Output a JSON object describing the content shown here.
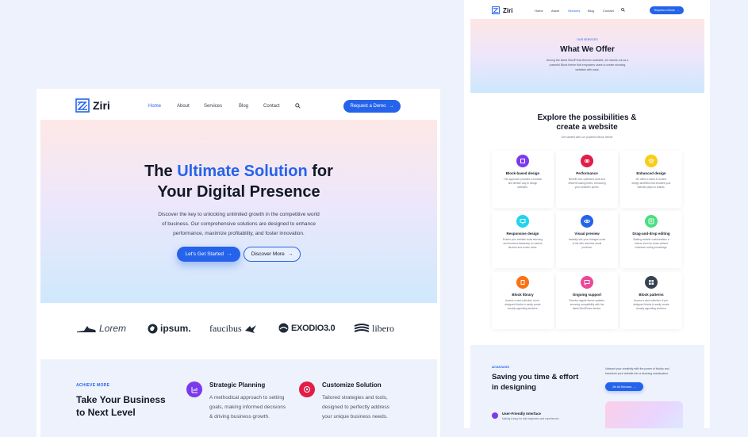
{
  "left": {
    "brand": "Ziri",
    "nav": [
      "Home",
      "About",
      "Services",
      "Blog",
      "Contact"
    ],
    "cta": "Request a Demo",
    "hero": {
      "title_pre": "The ",
      "title_accent": "Ultimate Solution",
      "title_post": " for",
      "title_line2": "Your Digital Presence",
      "desc": [
        "Discover the key to unlocking unlimited growth in the competitive world",
        "of business. Our comprehensive solutions are designed to enhance",
        "performance, maximize profitability, and foster innovation."
      ],
      "primary_button": "Let's Get Started",
      "secondary_button": "Discover More"
    },
    "logos": [
      "Lorem",
      "ipsum.",
      "faucibus",
      "EXODIO3.0",
      "libero"
    ],
    "features": {
      "kicker": "ACHIEVE MORE",
      "title_line1": "Take Your Business",
      "title_line2": "to Next Level",
      "items": [
        {
          "title": "Strategic Planning",
          "desc": [
            "A methodical approach to setting",
            "goals, making informed decisions",
            "& driving business growth."
          ],
          "color": "#7c3aed"
        },
        {
          "title": "Customize Solution",
          "desc": [
            "Tailored strategies and tools,",
            "designed to perfectly address",
            "your unique business needs."
          ],
          "color": "#e11d48"
        }
      ]
    }
  },
  "right": {
    "brand": "Ziri",
    "nav": [
      "Home",
      "Asset",
      "Services",
      "Blog",
      "Contact"
    ],
    "cta": "Request a Demo",
    "hero": {
      "kicker": "OUR SERVICES",
      "title": "What We Offer",
      "desc": [
        "Among the latest WordPress themes available, Ziri stands out as a",
        "powerful Block theme that empowers users to create stunning",
        "websites with ease."
      ]
    },
    "explore": {
      "title_line1": "Explore the possibilities &",
      "title_line2": "create a website",
      "sub": "Get started with our powerful Block theme"
    },
    "cards": [
      {
        "title": "Block-based design",
        "desc": [
          "This approach provides a modular",
          "and flexible way to design",
          "websites."
        ],
        "color": "#7c3aed",
        "icon": "cube-icon"
      },
      {
        "title": "Performance",
        "desc": [
          "Benefit from optimized code and",
          "efficient loading times, enhancing",
          "your website's speed."
        ],
        "color": "#e11d48",
        "icon": "link-icon"
      },
      {
        "title": "Enhanced design",
        "desc": [
          "Ziri offers a sleek & modern",
          "design aesthetic that elevates your",
          "website plays on brands."
        ],
        "color": "#facc15",
        "icon": "stack-icon"
      },
      {
        "title": "Responsive design",
        "desc": [
          "Ensure your website looks stunning",
          "and functions flawlessly on various",
          "devices and screen sizes."
        ],
        "color": "#22d3ee",
        "icon": "devices-icon"
      },
      {
        "title": "Visual preview",
        "desc": [
          "Instantly see your changes come",
          "to life with real-time visual",
          "previews."
        ],
        "color": "#2563eb",
        "icon": "eye-icon"
      },
      {
        "title": "Drag-and-drop editing",
        "desc": [
          "Making website customization a",
          "breeze even for those without",
          "extensive coding knowledge."
        ],
        "color": "#4ade80",
        "icon": "drag-icon"
      },
      {
        "title": "Block library",
        "desc": [
          "Access a vast collection of pre-",
          "designed blocks to easily create",
          "visually appealing sections."
        ],
        "color": "#f97316",
        "icon": "book-icon"
      },
      {
        "title": "Ongoing support",
        "desc": [
          "Receive regular theme updates,",
          "ensuring compatibility with the",
          "latest WordPress version."
        ],
        "color": "#ec4899",
        "icon": "chat-icon"
      },
      {
        "title": "Block patterns",
        "desc": [
          "Access a vast collection of pre-",
          "designed blocks to easily create",
          "visually appealing sections."
        ],
        "color": "#374151",
        "icon": "pattern-icon"
      }
    ],
    "bottom": {
      "kicker": "ADVANTAGES",
      "title_line1": "Saving you time & effort",
      "title_line2": "in designing",
      "side": [
        "Unleash your creativity with the power of blocks and",
        "transform your website into a stunning masterpiece."
      ],
      "button": "Ziri All Services",
      "feature_title": "User-Friendly Interface",
      "feature_desc": "Making it easy for both beginners and experienced"
    }
  }
}
